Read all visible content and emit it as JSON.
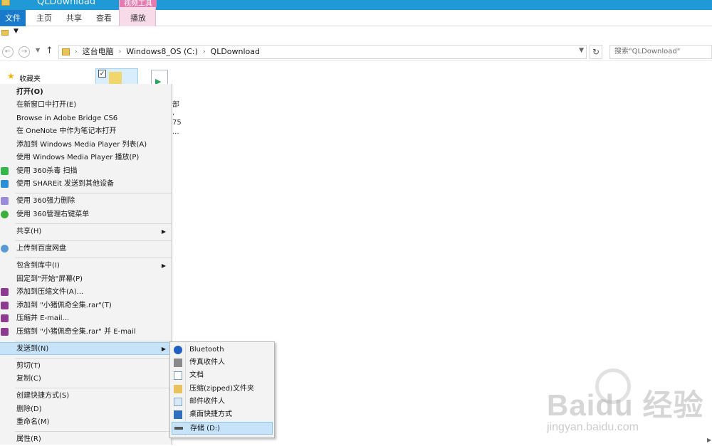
{
  "window": {
    "title": "QLDownload",
    "contextual_tab_group": "视频工具"
  },
  "ribbon": {
    "tabs": [
      "文件",
      "主页",
      "共享",
      "查看",
      "播放"
    ]
  },
  "address_bar": {
    "breadcrumbs": [
      "这台电脑",
      "Windows8_OS (C:)",
      "QLDownload"
    ],
    "search_placeholder": "搜索\"QLDownload\""
  },
  "nav_pane": {
    "favorites_label": "收藏夹"
  },
  "file_area": {
    "fragments": [
      "部",
      ",",
      "75",
      "..."
    ]
  },
  "context_menu": {
    "items": [
      {
        "label": "打开(O)"
      },
      {
        "label": "在新窗口中打开(E)"
      },
      {
        "label": "Browse in Adobe Bridge CS6"
      },
      {
        "label": "在 OneNote 中作为笔记本打开"
      },
      {
        "label": "添加到 Windows Media Player 列表(A)"
      },
      {
        "label": "使用 Windows Media Player 播放(P)"
      },
      {
        "label": "使用 360杀毒 扫描"
      },
      {
        "label": "使用 SHAREit 发送到其他设备"
      },
      {
        "label": "使用 360强力删除"
      },
      {
        "label": "使用 360管理右键菜单"
      },
      {
        "label": "共享(H)"
      },
      {
        "label": "上传到百度网盘"
      },
      {
        "label": "包含到库中(I)"
      },
      {
        "label": "固定到\"开始\"屏幕(P)"
      },
      {
        "label": "添加到压缩文件(A)..."
      },
      {
        "label": "添加到 \"小猪佩奇全集.rar\"(T)"
      },
      {
        "label": "压缩并 E-mail..."
      },
      {
        "label": "压缩到 \"小猪佩奇全集.rar\" 并 E-mail"
      },
      {
        "label": "发送到(N)"
      },
      {
        "label": "剪切(T)"
      },
      {
        "label": "复制(C)"
      },
      {
        "label": "创建快捷方式(S)"
      },
      {
        "label": "删除(D)"
      },
      {
        "label": "重命名(M)"
      },
      {
        "label": "属性(R)"
      }
    ]
  },
  "send_to_menu": {
    "items": [
      {
        "label": "Bluetooth",
        "icon": "bluetooth-icon"
      },
      {
        "label": "传真收件人",
        "icon": "fax-icon"
      },
      {
        "label": "文档",
        "icon": "documents-icon"
      },
      {
        "label": "压缩(zipped)文件夹",
        "icon": "zip-folder-icon"
      },
      {
        "label": "邮件收件人",
        "icon": "mail-icon"
      },
      {
        "label": "桌面快捷方式",
        "icon": "desktop-icon"
      },
      {
        "label": "存储 (D:)",
        "icon": "drive-icon"
      }
    ]
  },
  "watermark": {
    "brand_cn": "经验",
    "url": "jingyan.baidu.com"
  },
  "colors": {
    "title_bar": "#1f9ad6",
    "file_tab": "#1979ca",
    "contextual_tab": "#e37cb0",
    "menu_bg": "#f3f3f3",
    "highlight": "#c7e3f9"
  }
}
